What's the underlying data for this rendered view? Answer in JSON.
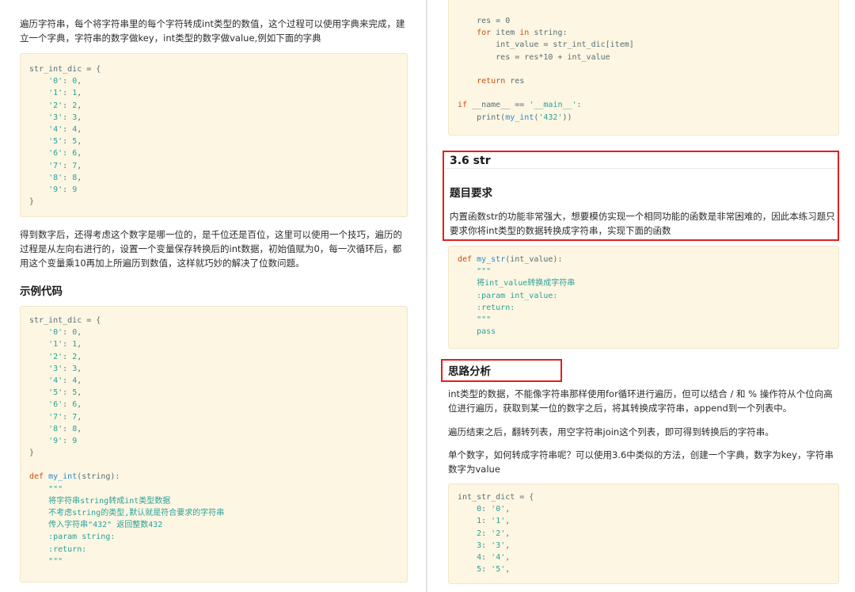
{
  "left": {
    "intro": "遍历字符串，每个将字符串里的每个字符转成int类型的数值，这个过程可以使用字典来完成，建立一个字典，字符串的数字做key，int类型的数字做value,例如下面的字典",
    "code1": [
      "str_int_dic = {",
      "    '0': 0,",
      "    '1': 1,",
      "    '2': 2,",
      "    '3': 3,",
      "    '4': 4,",
      "    '5': 5,",
      "    '6': 6,",
      "    '7': 7,",
      "    '8': 8,",
      "    '9': 9",
      "}"
    ],
    "para2": "得到数字后，还得考虑这个数字是哪一位的，是千位还是百位，这里可以使用一个技巧，遍历的过程是从左向右进行的，设置一个变量保存转换后的int数据，初始值赋为0，每一次循环后，都用这个变量乘10再加上所遍历到数值，这样就巧妙的解决了位数问题。",
    "heading": "示例代码",
    "code2": [
      "str_int_dic = {",
      "    '0': 0,",
      "    '1': 1,",
      "    '2': 2,",
      "    '3': 3,",
      "    '4': 4,",
      "    '5': 5,",
      "    '6': 6,",
      "    '7': 7,",
      "    '8': 8,",
      "    '9': 9",
      "}",
      "",
      "def my_int(string):",
      "    \"\"\"",
      "    将字符串string转成int类型数据",
      "    不考虑string的类型,默认就是符合要求的字符串",
      "    传入字符串\"432\" 返回整数432",
      "    :param string:",
      "    :return:",
      "    \"\"\""
    ]
  },
  "right": {
    "code_top": [
      "    res = 0",
      "    for item in string:",
      "        int_value = str_int_dic[item]",
      "        res = res*10 + int_value",
      "",
      "    return res",
      "",
      "if __name__ == '__main__':",
      "    print(my_int('432'))"
    ],
    "section_title": "3.6 str",
    "subheading": "题目要求",
    "requirement": "内置函数str的功能非常强大，想要模仿实现一个相同功能的函数是非常困难的，因此本练习题只要求你将int类型的数据转换成字符串，实现下面的函数",
    "code_mid": [
      "def my_str(int_value):",
      "    \"\"\"",
      "    将int_value转换成字符串",
      "    :param int_value:",
      "    :return:",
      "    \"\"\"",
      "    pass"
    ],
    "analysis_heading": "思路分析",
    "analysis1": "int类型的数据，不能像字符串那样使用for循环进行遍历，但可以结合 / 和 % 操作符从个位向高位进行遍历，获取到某一位的数字之后，将其转换成字符串，append到一个列表中。",
    "analysis2": "遍历结束之后，翻转列表，用空字符串join这个列表，即可得到转换后的字符串。",
    "analysis3": "单个数字，如何转成字符串呢？可以使用3.6中类似的方法，创建一个字典，数字为key，字符串数字为value",
    "code_bottom": [
      "int_str_dict = {",
      "    0: '0',",
      "    1: '1',",
      "    2: '2',",
      "    3: '3',",
      "    4: '4',",
      "    5: '5',"
    ]
  },
  "colors": {
    "highlight_border": "#e02020",
    "code_bg": "#fdf6e3",
    "string": "#2aa198",
    "keyword": "#cb4b16",
    "function": "#268bd2"
  }
}
